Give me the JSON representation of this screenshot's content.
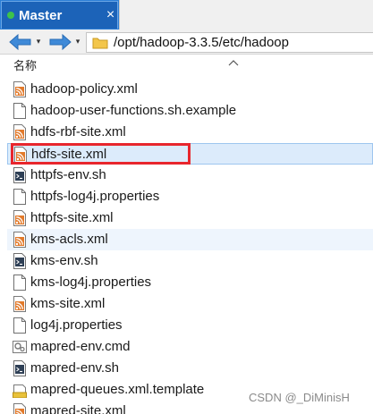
{
  "tab": {
    "label": "Master",
    "close_glyph": "×"
  },
  "address": {
    "back_icon": "back-arrow-icon",
    "forward_icon": "forward-arrow-icon",
    "dropdown_glyph": "▾",
    "path": "/opt/hadoop-3.3.5/etc/hadoop"
  },
  "list": {
    "column_name": "名称",
    "rows": [
      {
        "name": "hadoop-policy.xml",
        "icon": "xml-file-icon"
      },
      {
        "name": "hadoop-user-functions.sh.example",
        "icon": "text-file-icon"
      },
      {
        "name": "hdfs-rbf-site.xml",
        "icon": "xml-file-icon"
      },
      {
        "name": "hdfs-site.xml",
        "icon": "xml-file-icon",
        "selected": true
      },
      {
        "name": "httpfs-env.sh",
        "icon": "shell-file-icon"
      },
      {
        "name": "httpfs-log4j.properties",
        "icon": "text-file-icon"
      },
      {
        "name": "httpfs-site.xml",
        "icon": "xml-file-icon"
      },
      {
        "name": "kms-acls.xml",
        "icon": "xml-file-icon",
        "soft": true
      },
      {
        "name": "kms-env.sh",
        "icon": "shell-file-icon"
      },
      {
        "name": "kms-log4j.properties",
        "icon": "text-file-icon"
      },
      {
        "name": "kms-site.xml",
        "icon": "xml-file-icon"
      },
      {
        "name": "log4j.properties",
        "icon": "text-file-icon"
      },
      {
        "name": "mapred-env.cmd",
        "icon": "cmd-file-icon"
      },
      {
        "name": "mapred-env.sh",
        "icon": "shell-file-icon"
      },
      {
        "name": "mapred-queues.xml.template",
        "icon": "template-file-icon"
      },
      {
        "name": "mapred-site.xml",
        "icon": "xml-file-icon"
      }
    ]
  },
  "watermark": "CSDN @_DiMinisH",
  "colors": {
    "tab_active": "#1c63b8",
    "tabbar": "#2d7fd6",
    "selection": "#dcebfb",
    "highlight_border": "#e8262d",
    "xml_icon": "#e27a2b"
  }
}
